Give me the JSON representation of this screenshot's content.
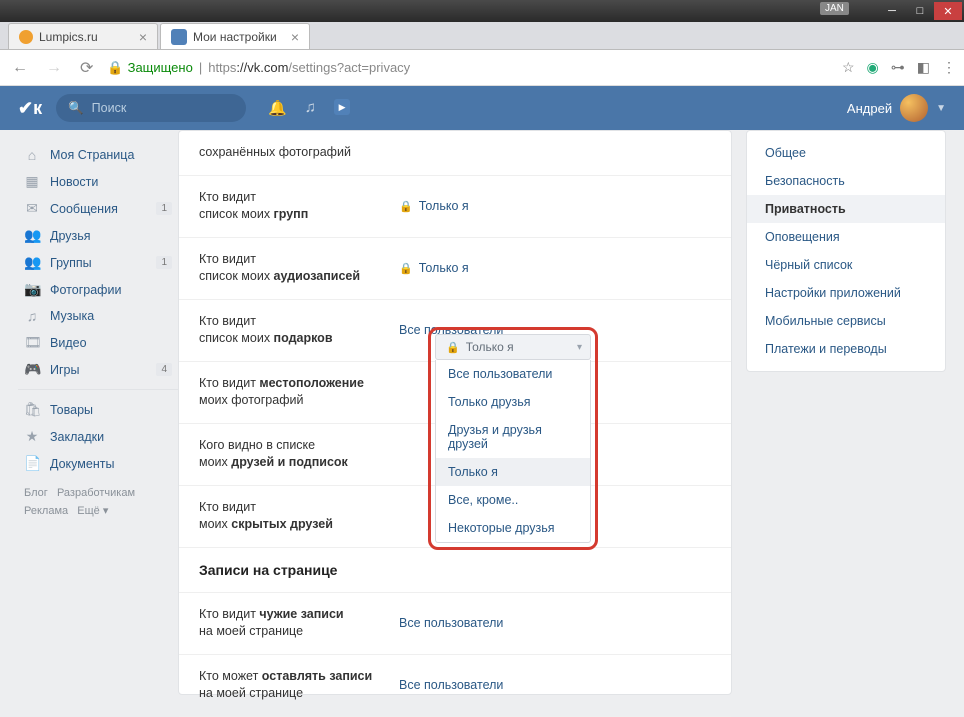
{
  "titlebar": {
    "badge": "JAN"
  },
  "tabs": [
    {
      "title": "Lumpics.ru",
      "fav_color": "#f0a030"
    },
    {
      "title": "Мои настройки",
      "fav_color": "#4a76a8"
    }
  ],
  "addr": {
    "secure_label": "Защищено",
    "proto": "https",
    "host": "://vk.com",
    "path": "/settings?act=privacy"
  },
  "header": {
    "search_placeholder": "Поиск",
    "user_name": "Андрей"
  },
  "leftnav": {
    "items": [
      {
        "icon": "⌂",
        "label": "Моя Страница"
      },
      {
        "icon": "▦",
        "label": "Новости"
      },
      {
        "icon": "✉",
        "label": "Сообщения",
        "count": "1"
      },
      {
        "icon": "👥",
        "label": "Друзья"
      },
      {
        "icon": "👥",
        "label": "Группы",
        "count": "1"
      },
      {
        "icon": "📷",
        "label": "Фотографии"
      },
      {
        "icon": "♫",
        "label": "Музыка"
      },
      {
        "icon": "🎞",
        "label": "Видео"
      },
      {
        "icon": "🎮",
        "label": "Игры",
        "count": "4"
      }
    ],
    "items2": [
      {
        "icon": "🛍",
        "label": "Товары"
      },
      {
        "icon": "★",
        "label": "Закладки"
      },
      {
        "icon": "📄",
        "label": "Документы"
      }
    ],
    "footer": {
      "blog": "Блог",
      "dev": "Разработчикам",
      "ads": "Реклама",
      "more": "Ещё ▾"
    }
  },
  "settings": {
    "rows": [
      {
        "l1": "сохранённых фотографий",
        "l2": "",
        "val": ""
      },
      {
        "l1": "Кто видит",
        "l2": "список моих ",
        "b": "групп",
        "val": "Только я",
        "lock": true
      },
      {
        "l1": "Кто видит",
        "l2": "список моих ",
        "b": "аудиозаписей",
        "val": "Только я",
        "lock": true
      },
      {
        "l1": "Кто видит",
        "l2": "список моих ",
        "b": "подарков",
        "val": "Все пользователи"
      },
      {
        "l1": "Кто видит ",
        "b1": "местоположение",
        "l2": "моих фотографий",
        "val": ""
      },
      {
        "l1": "Кого видно в списке",
        "l2": "моих ",
        "b": "друзей и подписок",
        "val": ""
      },
      {
        "l1": "Кто видит",
        "l2": "моих ",
        "b": "скрытых друзей",
        "val": ""
      }
    ],
    "section2_title": "Записи на странице",
    "rows2": [
      {
        "l1": "Кто видит ",
        "b1": "чужие записи",
        "l2": "на моей странице",
        "val": "Все пользователи"
      },
      {
        "l1": "Кто может ",
        "b1": "оставлять записи",
        "l2": "на моей странице",
        "val": "Все пользователи"
      }
    ]
  },
  "sidemenu": {
    "items": [
      "Общее",
      "Безопасность",
      "Приватность",
      "Оповещения",
      "Чёрный список",
      "Настройки приложений",
      "Мобильные сервисы",
      "Платежи и переводы"
    ],
    "active_index": 2
  },
  "dropdown": {
    "selected": "Только я",
    "options": [
      "Все пользователи",
      "Только друзья",
      "Друзья и друзья друзей",
      "Только я",
      "Все, кроме..",
      "Некоторые друзья"
    ],
    "selected_index": 3
  }
}
